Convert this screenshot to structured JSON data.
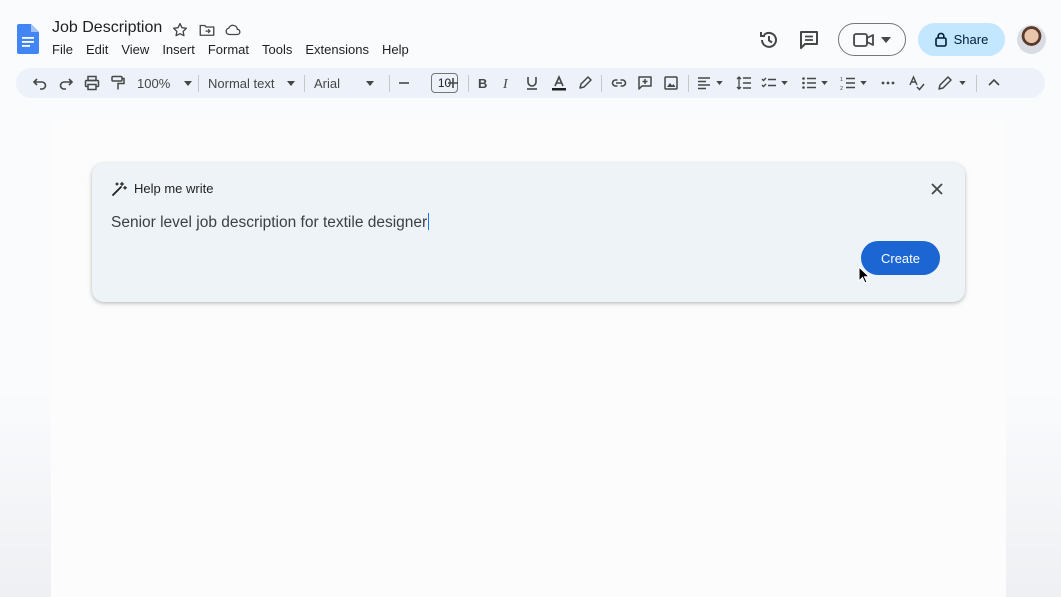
{
  "header": {
    "doc_title": "Job Description",
    "menu": [
      "File",
      "Edit",
      "View",
      "Insert",
      "Format",
      "Tools",
      "Extensions",
      "Help"
    ],
    "share_label": "Share"
  },
  "toolbar": {
    "zoom": "100%",
    "style": "Normal text",
    "font": "Arial",
    "font_size": "10"
  },
  "help_me_write": {
    "title": "Help me write",
    "prompt": "Senior level job description for textile designer",
    "create_label": "Create"
  },
  "colors": {
    "accent": "#1b66d2",
    "share_bg": "#c2e7ff",
    "toolbar_bg": "#edf2fa",
    "docs_blue": "#4285f4"
  }
}
